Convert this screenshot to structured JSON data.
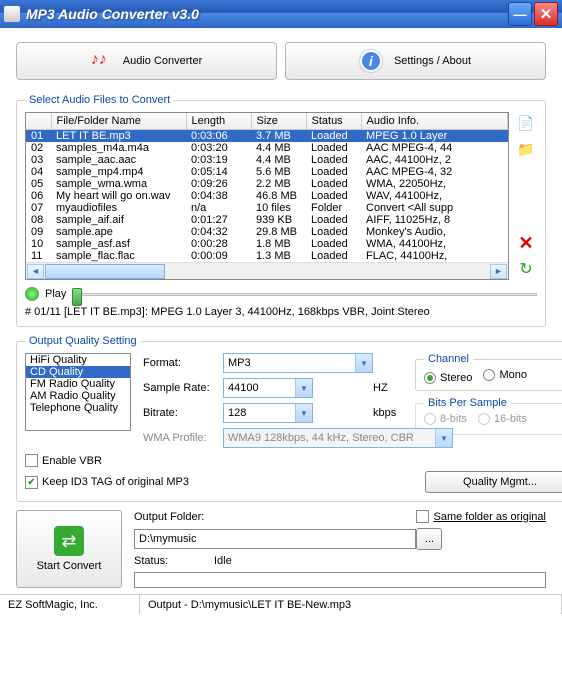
{
  "window": {
    "title": "MP3 Audio Converter v3.0"
  },
  "topbar": {
    "audio_converter": "Audio Converter",
    "settings_about": "Settings / About"
  },
  "filebox": {
    "legend": "Select Audio Files to Convert",
    "headers": {
      "num": "",
      "name": "File/Folder Name",
      "length": "Length",
      "size": "Size",
      "status": "Status",
      "info": "Audio Info."
    },
    "rows": [
      {
        "n": "01",
        "name": "LET IT BE.mp3",
        "length": "0:03:06",
        "size": "3.7 MB",
        "status": "Loaded",
        "info": "MPEG 1.0 Layer"
      },
      {
        "n": "02",
        "name": "samples_m4a.m4a",
        "length": "0:03:20",
        "size": "4.4 MB",
        "status": "Loaded",
        "info": "AAC MPEG-4, 44"
      },
      {
        "n": "03",
        "name": "sample_aac.aac",
        "length": "0:03:19",
        "size": "4.4 MB",
        "status": "Loaded",
        "info": "AAC, 44100Hz, 2"
      },
      {
        "n": "04",
        "name": "sample_mp4.mp4",
        "length": "0:05:14",
        "size": "5.6 MB",
        "status": "Loaded",
        "info": "AAC MPEG-4, 32"
      },
      {
        "n": "05",
        "name": "sample_wma.wma",
        "length": "0:09:26",
        "size": "2.2 MB",
        "status": "Loaded",
        "info": "WMA, 22050Hz,"
      },
      {
        "n": "06",
        "name": "My heart will go on.wav",
        "length": "0:04:38",
        "size": "46.8 MB",
        "status": "Loaded",
        "info": "WAV, 44100Hz,"
      },
      {
        "n": "07",
        "name": "myaudiofiles",
        "length": "n/a",
        "size": "10 files",
        "status": "Folder",
        "info": "Convert <All supp"
      },
      {
        "n": "08",
        "name": "sample_aif.aif",
        "length": "0:01:27",
        "size": "939 KB",
        "status": "Loaded",
        "info": "AIFF, 11025Hz, 8"
      },
      {
        "n": "09",
        "name": "sample.ape",
        "length": "0:04:32",
        "size": "29.8 MB",
        "status": "Loaded",
        "info": "Monkey's Audio,"
      },
      {
        "n": "10",
        "name": "sample_asf.asf",
        "length": "0:00:28",
        "size": "1.8 MB",
        "status": "Loaded",
        "info": "WMA, 44100Hz,"
      },
      {
        "n": "11",
        "name": "sample_flac.flac",
        "length": "0:00:09",
        "size": "1.3 MB",
        "status": "Loaded",
        "info": "FLAC, 44100Hz,"
      }
    ]
  },
  "play": {
    "label": "Play",
    "info": "# 01/11 [LET IT BE.mp3]: MPEG 1.0 Layer 3, 44100Hz, 168kbps VBR, Joint Stereo"
  },
  "output": {
    "legend": "Output Quality Setting",
    "presets": [
      "HiFi Quality",
      "CD Quality",
      "FM Radio Quality",
      "AM Radio Quality",
      "Telephone Quality"
    ],
    "selected_preset_index": 1,
    "format_label": "Format:",
    "format_value": "MP3",
    "samplerate_label": "Sample Rate:",
    "samplerate_value": "44100",
    "hz": "HZ",
    "bitrate_label": "Bitrate:",
    "bitrate_value": "128",
    "kbps": "kbps",
    "wmaprofile_label": "WMA Profile:",
    "wmaprofile_value": "WMA9 128kbps, 44 kHz, Stereo, CBR",
    "channel_legend": "Channel",
    "stereo": "Stereo",
    "mono": "Mono",
    "bits_legend": "Bits Per Sample",
    "bits8": "8-bits",
    "bits16": "16-bits",
    "enable_vbr": "Enable VBR",
    "keep_id3": "Keep ID3 TAG of original MP3",
    "quality_mgmt": "Quality Mgmt..."
  },
  "bottom": {
    "start_convert": "Start Convert",
    "output_folder_label": "Output Folder:",
    "output_folder_value": "D:\\mymusic",
    "same_folder": "Same folder as original",
    "status_label": "Status:",
    "status_value": "Idle",
    "browse": "..."
  },
  "statusbar": {
    "company": "EZ SoftMagic, Inc.",
    "output": "Output - D:\\mymusic\\LET IT BE-New.mp3"
  }
}
